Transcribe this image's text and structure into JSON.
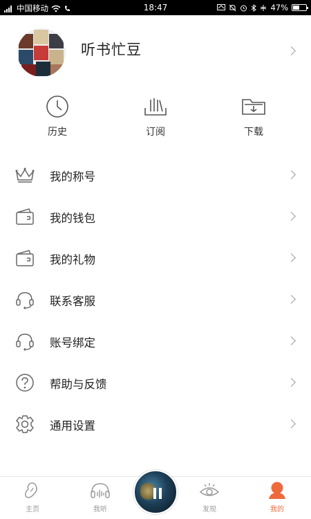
{
  "status_bar": {
    "carrier": "中国移动",
    "time": "18:47",
    "battery": "47%"
  },
  "profile": {
    "username": "听书忙豆"
  },
  "quick_actions": [
    {
      "label": "历史",
      "icon": "clock-icon"
    },
    {
      "label": "订阅",
      "icon": "subscription-icon"
    },
    {
      "label": "下载",
      "icon": "download-folder-icon"
    }
  ],
  "menu": [
    {
      "label": "我的称号",
      "icon": "crown-icon"
    },
    {
      "label": "我的钱包",
      "icon": "wallet-icon"
    },
    {
      "label": "我的礼物",
      "icon": "gift-wallet-icon"
    },
    {
      "label": "联系客服",
      "icon": "headset-icon"
    },
    {
      "label": "账号绑定",
      "icon": "headset-icon"
    },
    {
      "label": "帮助与反馈",
      "icon": "help-icon"
    },
    {
      "label": "通用设置",
      "icon": "settings-gear-icon"
    }
  ],
  "bottom_nav": {
    "tabs": [
      {
        "label": "主页",
        "icon": "bean-home-icon"
      },
      {
        "label": "我听",
        "icon": "headphones-icon"
      },
      {
        "label": "发现",
        "icon": "eye-icon"
      },
      {
        "label": "我的",
        "icon": "user-icon"
      }
    ],
    "active_index": 3,
    "active_color": "#ee6a3c",
    "inactive_color": "#999999"
  }
}
